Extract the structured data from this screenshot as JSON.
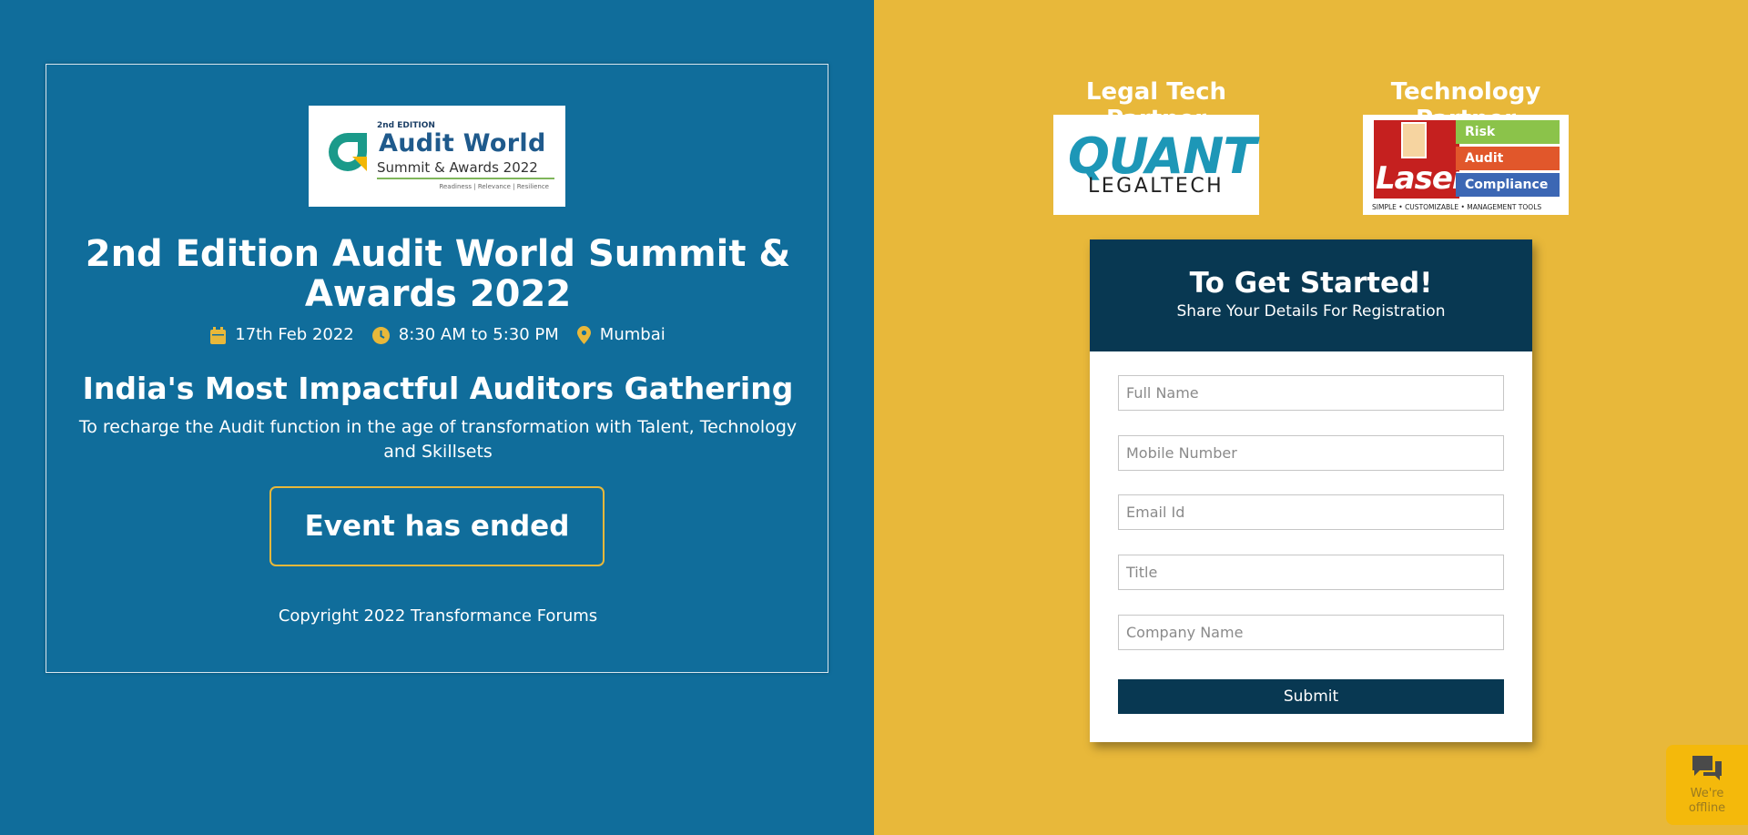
{
  "event": {
    "logo": {
      "edition": "2nd EDITION",
      "line1": "Audit World",
      "line2": "Summit & Awards 2022",
      "tagline": "Readiness | Relevance | Resilience"
    },
    "title": "2nd Edition Audit World Summit & Awards 2022",
    "date": "17th Feb 2022",
    "time": "8:30 AM to 5:30 PM",
    "location": "Mumbai",
    "subtitle": "India's Most Impactful Auditors Gathering",
    "description": "To recharge the Audit function in the age of transformation with Talent, Technology and Skillsets",
    "status_button": "Event has ended",
    "copyright": "Copyright 2022 Transformance Forums"
  },
  "partners": [
    {
      "heading": "Legal Tech Partner",
      "logo_main": "QUANT",
      "logo_sub": "LEGALTECH"
    },
    {
      "heading": "Technology Partner",
      "logo_word": "Laser",
      "logo_bars": [
        "Risk",
        "Audit",
        "Compliance"
      ],
      "logo_footer": "SIMPLE • CUSTOMIZABLE • MANAGEMENT TOOLS"
    }
  ],
  "form": {
    "heading": "To Get Started!",
    "subheading": "Share Your Details For Registration",
    "fields": {
      "full_name": "Full Name",
      "mobile": "Mobile Number",
      "email": "Email Id",
      "title": "Title",
      "company": "Company Name"
    },
    "submit_label": "Submit"
  },
  "chat": {
    "status_line1": "We're",
    "status_line2": "offline"
  },
  "colors": {
    "left_bg": "#106d9b",
    "right_bg": "#e8b83a",
    "form_header": "#083852",
    "accent": "#e8b83a"
  }
}
